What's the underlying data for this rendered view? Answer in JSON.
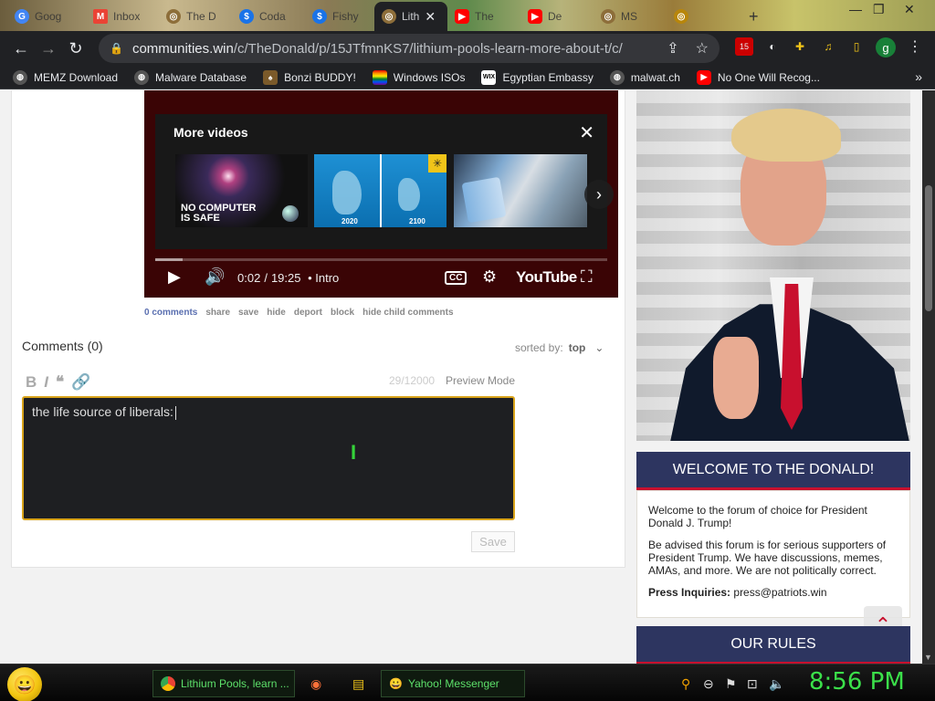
{
  "browser": {
    "tabs": [
      {
        "label": "Goog"
      },
      {
        "label": "Inbox"
      },
      {
        "label": "The D"
      },
      {
        "label": "Coda"
      },
      {
        "label": "Fishy"
      },
      {
        "label": "Lith",
        "active": true
      },
      {
        "label": "The"
      },
      {
        "label": "De"
      },
      {
        "label": "MS"
      },
      {
        "label": ""
      }
    ],
    "new_tab": "+",
    "url_host": "communities.win",
    "url_path": "/c/TheDonald/p/15JTfmnKS7/lithium-pools-learn-more-about-t/c/",
    "ext_badge": "15",
    "profile_initial": "g"
  },
  "bookmarks": [
    {
      "label": "MEMZ Download"
    },
    {
      "label": "Malware Database"
    },
    {
      "label": "Bonzi BUDDY!"
    },
    {
      "label": "Windows ISOs"
    },
    {
      "label": "Egyptian Embassy"
    },
    {
      "label": "malwat.ch"
    },
    {
      "label": "No One Will Recog..."
    }
  ],
  "video": {
    "more_videos_title": "More videos",
    "thumbs": [
      {
        "text_line1": "NO COMPUTER",
        "text_line2": "IS SAFE"
      },
      {
        "year_left": "2020",
        "year_right": "2100"
      },
      {}
    ],
    "time_current": "0:02",
    "time_total": "19:25",
    "chapter": "• Intro",
    "cc_label": "CC",
    "logo": "YouTube"
  },
  "post_actions": {
    "comments": "0 comments",
    "share": "share",
    "save": "save",
    "hide": "hide",
    "deport": "deport",
    "block": "block",
    "hide_child": "hide child comments"
  },
  "comments": {
    "heading": "Comments (0)",
    "sorted_label": "sorted by:",
    "sorted_value": "top",
    "counter": "29/12000",
    "preview_mode": "Preview Mode",
    "textarea_value": "the life source of liberals:",
    "save_button": "Save"
  },
  "sidebar": {
    "welcome_title": "WELCOME TO THE DONALD!",
    "welcome_p1": "Welcome to the forum of choice for President Donald J. Trump!",
    "welcome_p2": "Be advised this forum is for serious supporters of President Trump. We have discussions, memes, AMAs, and more. We are not politically correct.",
    "press_label": "Press Inquiries:",
    "press_email": "press@patriots.win",
    "rules_title": "OUR RULES"
  },
  "taskbar": {
    "chrome_task": "Lithium Pools, learn ...",
    "yahoo_task": "Yahoo! Messenger",
    "clock": "8:56 PM"
  },
  "colors": {
    "accent_navy": "#2d3560",
    "accent_red": "#c8102e",
    "textarea_border": "#d8a31a",
    "clock_green": "#3be04a"
  }
}
